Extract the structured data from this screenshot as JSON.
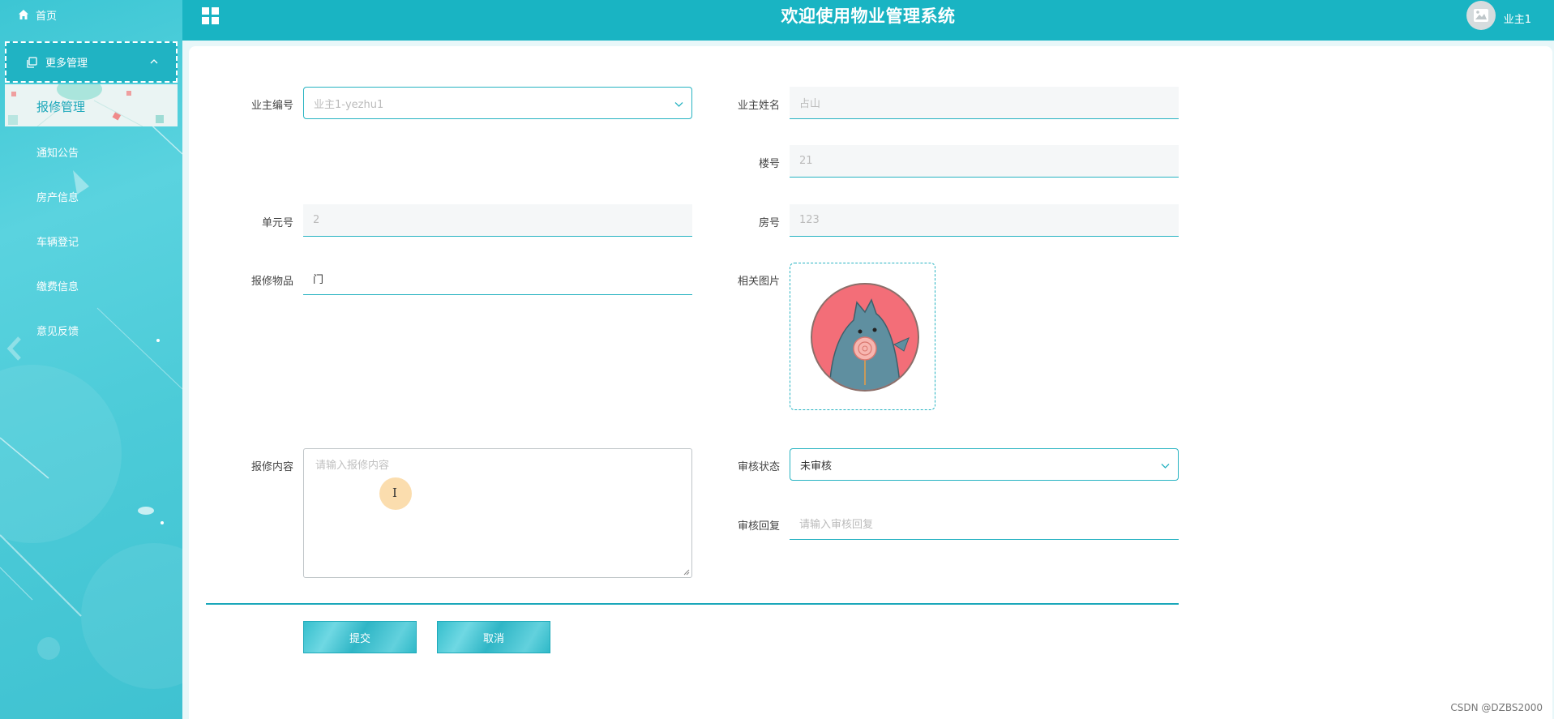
{
  "header": {
    "title": "欢迎使用物业管理系统",
    "user_name": "业主1",
    "grid_icon": "grid-icon",
    "avatar_icon": "image-icon"
  },
  "sidebar": {
    "home_label": "首页",
    "group_label": "更多管理",
    "active_item": "报修管理",
    "items": [
      "通知公告",
      "房产信息",
      "车辆登记",
      "缴费信息",
      "意见反馈"
    ]
  },
  "form": {
    "owner_id_label": "业主编号",
    "owner_id_value": "业主1-yezhu1",
    "owner_name_label": "业主姓名",
    "owner_name_value": "占山",
    "building_label": "楼号",
    "building_value": "21",
    "unit_label": "单元号",
    "unit_value": "2",
    "room_label": "房号",
    "room_value": "123",
    "item_label": "报修物品",
    "item_value": "门",
    "image_label": "相关图片",
    "content_label": "报修内容",
    "content_placeholder": "请输入报修内容",
    "status_label": "审核状态",
    "status_value": "未审核",
    "reply_label": "审核回复",
    "reply_placeholder": "请输入审核回复",
    "submit_label": "提交",
    "cancel_label": "取消"
  },
  "watermark": "CSDN @DZBS2000",
  "colors": {
    "accent": "#19b4c3",
    "sidebar": "#4ccbd8",
    "active_text": "#1aa7ba"
  }
}
